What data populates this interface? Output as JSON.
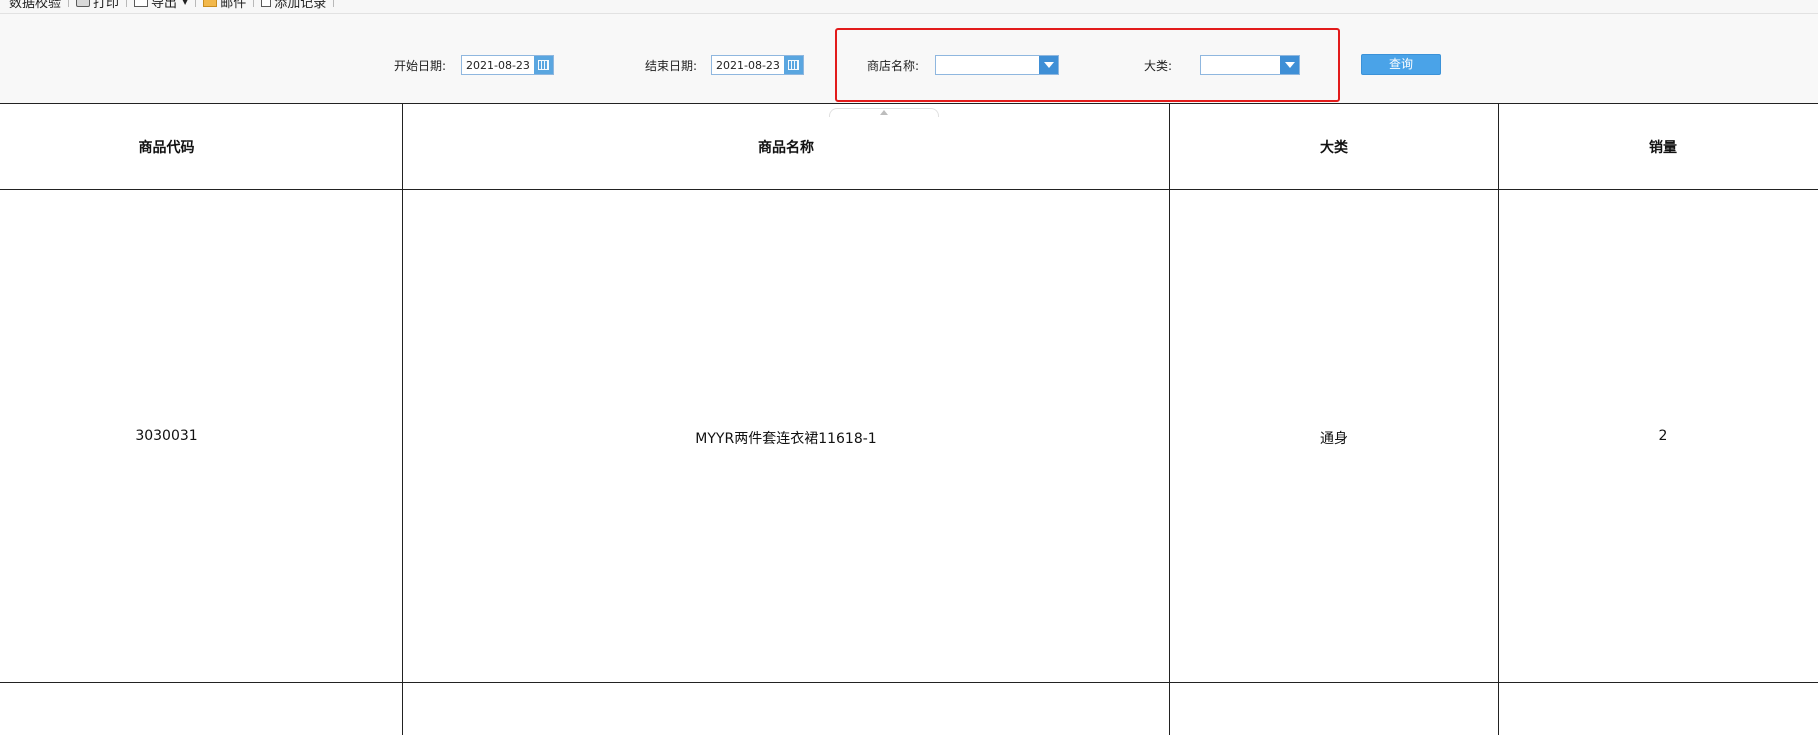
{
  "toolbar": {
    "items": [
      {
        "label": "数据校验",
        "icon": "check-icon"
      },
      {
        "label": "打印",
        "icon": "printer-icon"
      },
      {
        "label": "导出",
        "icon": "export-icon"
      },
      {
        "label": "邮件",
        "icon": "mail-icon"
      },
      {
        "label": "添加记录",
        "icon": "add-record-icon"
      }
    ]
  },
  "filters": {
    "start_date_label": "开始日期:",
    "start_date_value": "2021-08-23",
    "end_date_label": "结束日期:",
    "end_date_value": "2021-08-23",
    "store_label": "商店名称:",
    "store_value": "",
    "category_label": "大类:",
    "category_value": "",
    "query_button": "查询",
    "highlight_color": "#e21b1b"
  },
  "table": {
    "columns": [
      "商品代码",
      "商品名称",
      "大类",
      "销量"
    ],
    "rows": [
      {
        "code": "3030031",
        "name": "MYYR两件套连衣裙11618-1",
        "category": "通身",
        "qty": "2"
      }
    ]
  },
  "colors": {
    "accent": "#4aa3e8",
    "combo_arrow": "#3f8fd6",
    "border_blue": "#8fb7df"
  }
}
